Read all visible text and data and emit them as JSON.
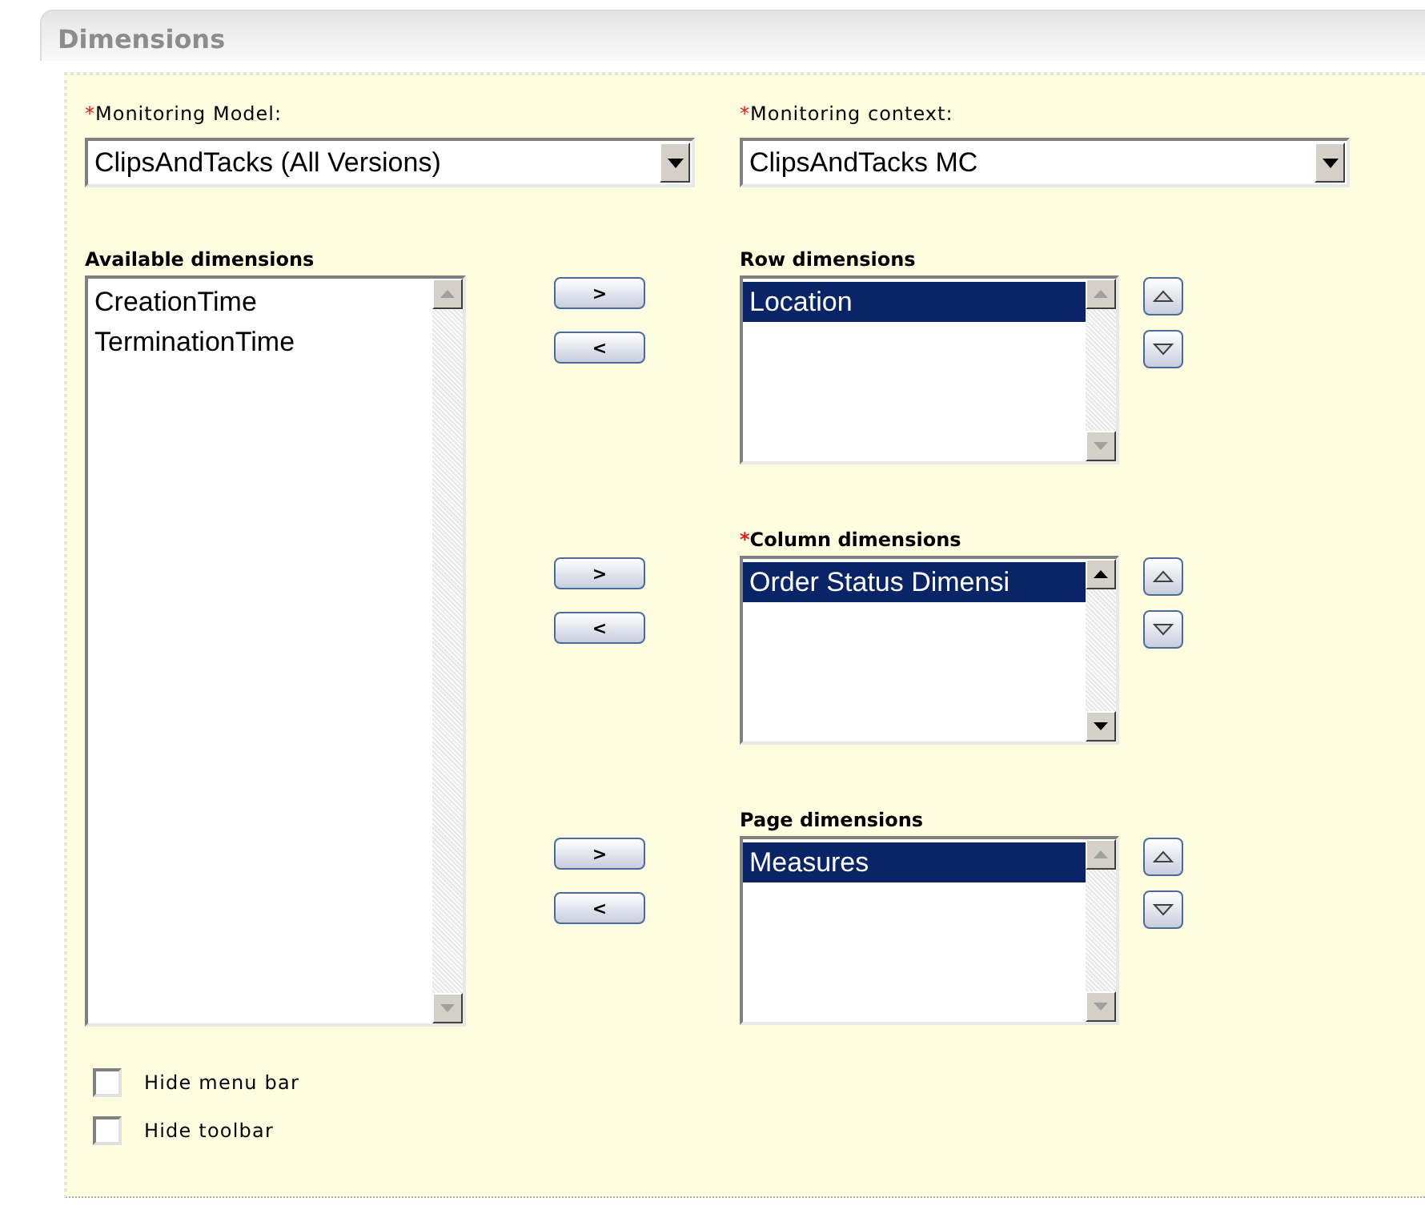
{
  "section": {
    "title": "Dimensions"
  },
  "selects": [
    {
      "label": "Monitoring Model:",
      "required_mark": "*",
      "value": "ClipsAndTacks (All Versions)"
    },
    {
      "label": "Monitoring context:",
      "required_mark": "*",
      "value": "ClipsAndTacks MC"
    }
  ],
  "available": {
    "label": "Available dimensions",
    "scroll_enabled": false,
    "items": [
      {
        "text": "CreationTime",
        "selected": false
      },
      {
        "text": "TerminationTime",
        "selected": false
      }
    ]
  },
  "move_buttons": [
    ">",
    "<"
  ],
  "targets": [
    {
      "label": "Row dimensions",
      "scroll_enabled": false,
      "items": [
        {
          "text": "Location",
          "selected": true
        }
      ]
    },
    {
      "label": "Column dimensions",
      "required_mark": "*",
      "scroll_enabled": true,
      "items": [
        {
          "text": "Order Status Dimensi",
          "selected": true
        }
      ]
    },
    {
      "label": "Page dimensions",
      "scroll_enabled": false,
      "items": [
        {
          "text": "Measures",
          "selected": true
        }
      ]
    }
  ],
  "checkboxes": [
    {
      "label": "Hide menu bar",
      "checked": false
    },
    {
      "label": "Hide toolbar",
      "checked": false
    }
  ]
}
